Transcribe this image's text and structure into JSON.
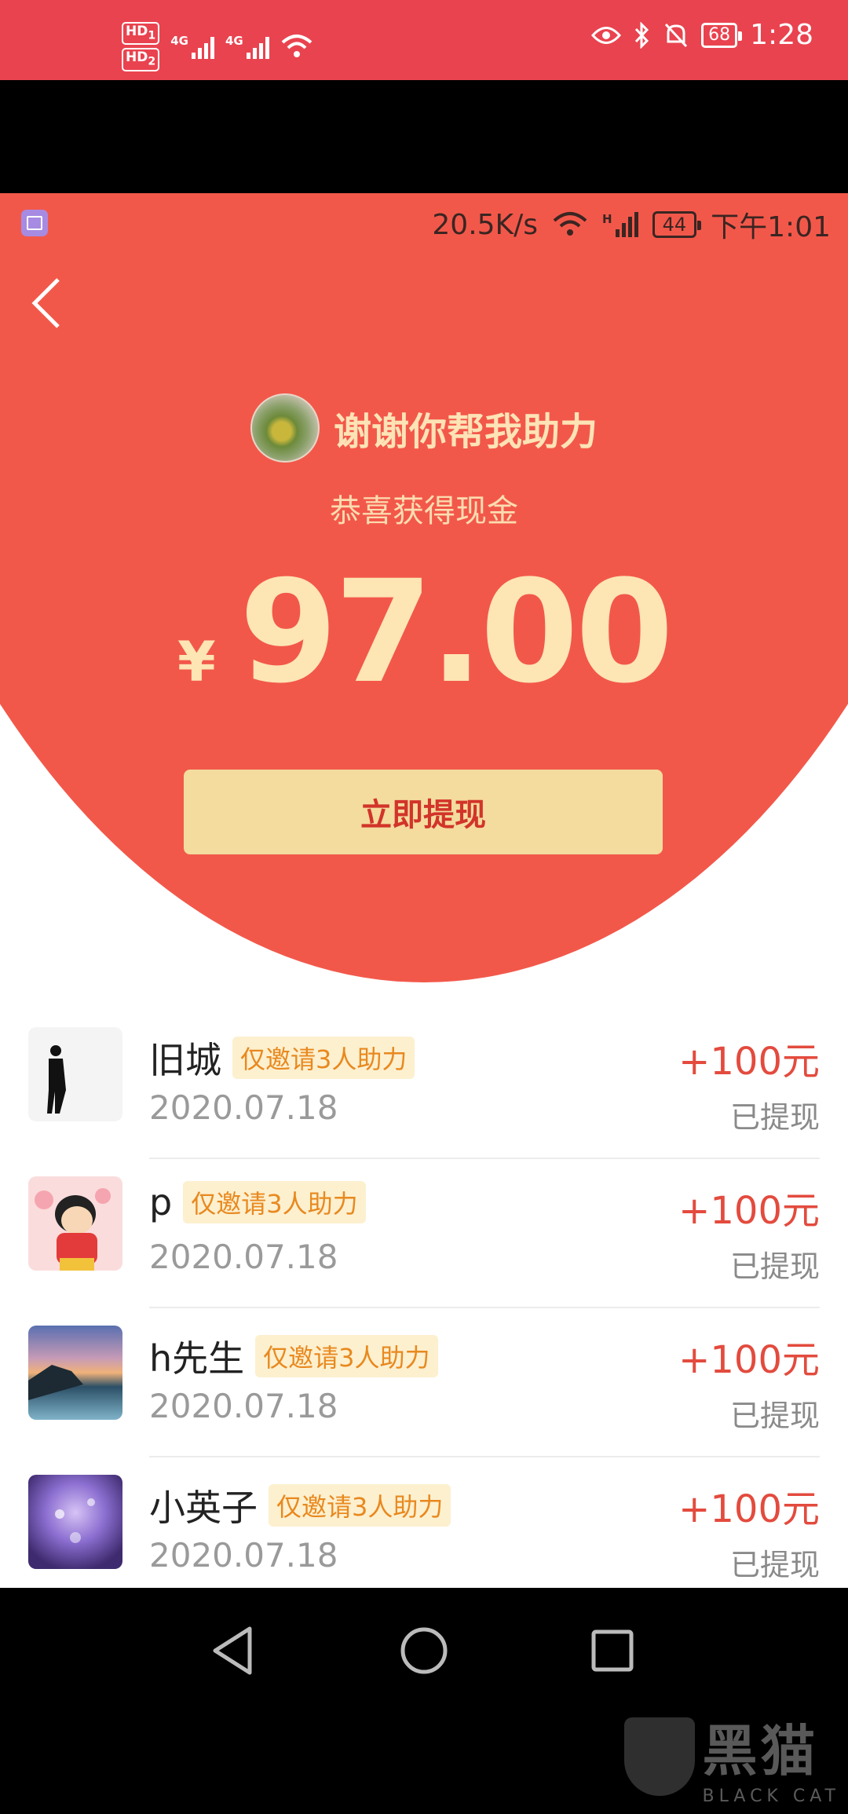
{
  "outer_status": {
    "sim1": "HD",
    "sim1_sub": "1",
    "sim2": "HD",
    "sim2_sub": "2",
    "net1": "4G",
    "net2": "4G",
    "battery": "68",
    "time": "1:28"
  },
  "inner_status": {
    "speed": "20.5K/s",
    "net": "H",
    "battery": "44",
    "time": "下午1:01"
  },
  "header": {
    "title": "谢谢你帮我助力"
  },
  "reward": {
    "label": "恭喜获得现金",
    "currency": "¥",
    "amount": "97.00",
    "button": "立即提现"
  },
  "list": [
    {
      "name": "旧城",
      "tag": "仅邀请3人助力",
      "date": "2020.07.18",
      "amount": "+100元",
      "status": "已提现"
    },
    {
      "name": "p",
      "tag": "仅邀请3人助力",
      "date": "2020.07.18",
      "amount": "+100元",
      "status": "已提现"
    },
    {
      "name": "h先生",
      "tag": "仅邀请3人助力",
      "date": "2020.07.18",
      "amount": "+100元",
      "status": "已提现"
    },
    {
      "name": "小英子",
      "tag": "仅邀请3人助力",
      "date": "2020.07.18",
      "amount": "+100元",
      "status": "已提现"
    }
  ],
  "watermark": {
    "text": "黑猫",
    "sub": "BLACK CAT"
  },
  "colors": {
    "header_red": "#f2584a",
    "status_red": "#e9434f",
    "button_yellow": "#f3dc9e",
    "amount_red": "#e34b3e",
    "tag_orange": "#e8891f"
  }
}
